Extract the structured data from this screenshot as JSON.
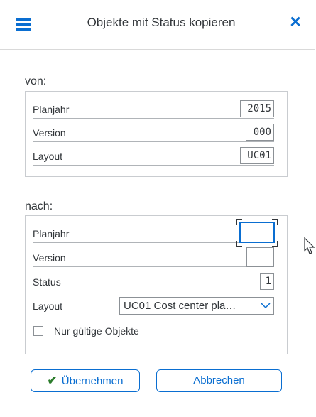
{
  "dialog": {
    "title": "Objekte mit Status kopieren",
    "icons": {
      "menu": "hamburger-menu-icon",
      "close": "close-x-icon"
    }
  },
  "from": {
    "label": "von:",
    "rows": [
      {
        "label": "Planjahr",
        "value": "2015"
      },
      {
        "label": "Version",
        "value": "000"
      },
      {
        "label": "Layout",
        "value": "UC01"
      }
    ]
  },
  "to": {
    "label": "nach:",
    "planjahr": {
      "label": "Planjahr",
      "value": ""
    },
    "version": {
      "label": "Version",
      "value": ""
    },
    "status": {
      "label": "Status",
      "value": "1"
    },
    "layout": {
      "label": "Layout",
      "selected": "UC01 Cost center pla…"
    },
    "checkbox": {
      "label": "Nur gültige Objekte",
      "checked": false
    }
  },
  "buttons": {
    "accept": "Übernehmen",
    "cancel": "Abbrechen"
  },
  "colors": {
    "accent": "#0a6ed1",
    "check": "#2b7c2b",
    "text": "#32363a"
  }
}
